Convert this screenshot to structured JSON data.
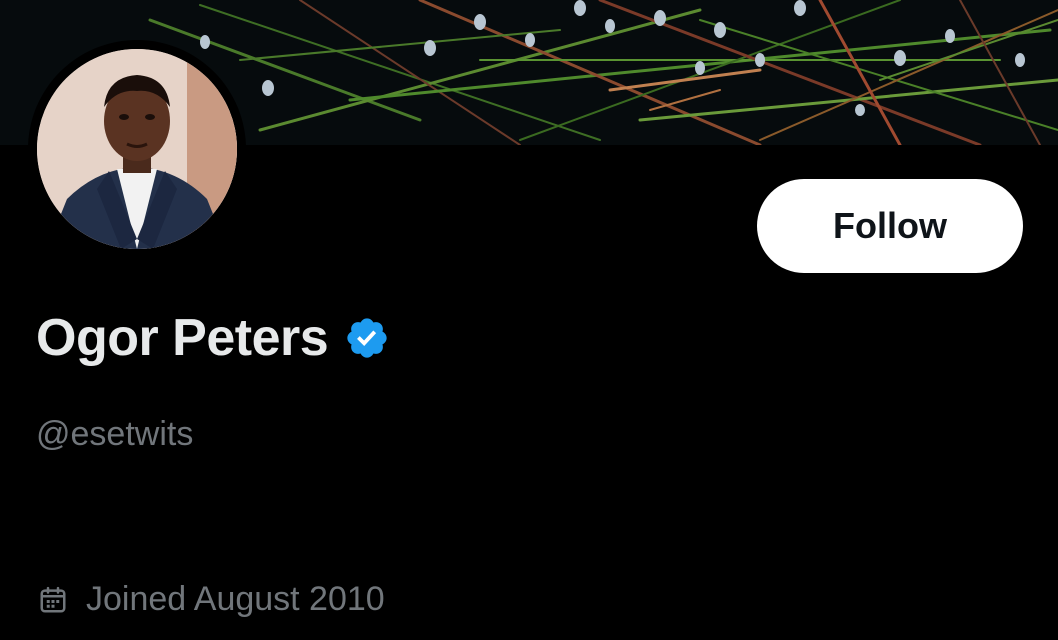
{
  "profile": {
    "display_name": "Ogor Peters",
    "handle": "@esetwits",
    "joined": "Joined August 2010",
    "verified": true
  },
  "actions": {
    "follow_label": "Follow"
  },
  "icons": {
    "verified": "verified-badge-icon",
    "calendar": "calendar-icon"
  },
  "colors": {
    "background": "#000000",
    "primary_text": "#e7e9ea",
    "secondary_text": "#71767b",
    "verified_blue": "#1d9bf0",
    "button_bg": "#ffffff"
  }
}
